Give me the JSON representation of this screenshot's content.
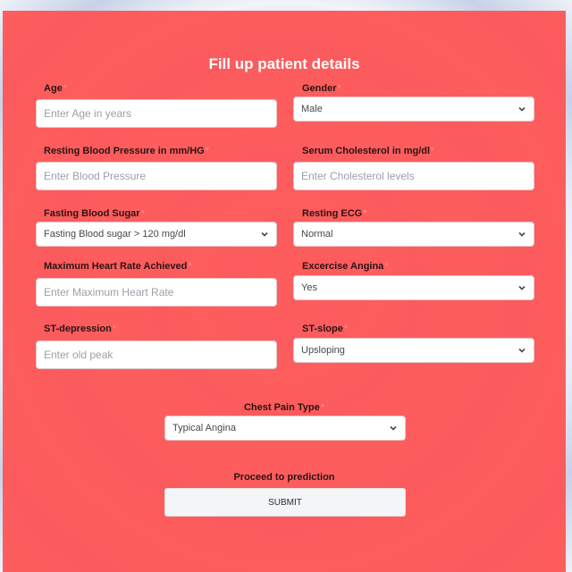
{
  "form": {
    "title": "Fill up patient details",
    "required_marker": "*",
    "age": {
      "label": "Age",
      "placeholder": "Enter Age in years"
    },
    "gender": {
      "label": "Gender",
      "value": "Male"
    },
    "resting_bp": {
      "label": "Resting Blood Pressure in mm/HG",
      "placeholder": "Enter Blood Pressure"
    },
    "cholesterol": {
      "label": "Serum Cholesterol in mg/dl",
      "placeholder": "Enter Cholesterol levels"
    },
    "fasting_bs": {
      "label": "Fasting Blood Sugar",
      "value": "Fasting Blood sugar > 120 mg/dl"
    },
    "resting_ecg": {
      "label": "Resting ECG",
      "value": "Normal"
    },
    "max_hr": {
      "label": "Maximum Heart Rate Achieved",
      "placeholder": "Enter Maximum Heart Rate"
    },
    "angina": {
      "label": "Excercise Angina",
      "value": "Yes"
    },
    "st_depression": {
      "label": "ST-depression",
      "placeholder": "Enter old peak"
    },
    "st_slope": {
      "label": "ST-slope",
      "value": "Upsloping"
    },
    "chest_pain": {
      "label": "Chest Pain Type",
      "value": "Typical Angina"
    },
    "proceed_label": "Proceed to prediction",
    "submit_label": "SUBMIT"
  }
}
